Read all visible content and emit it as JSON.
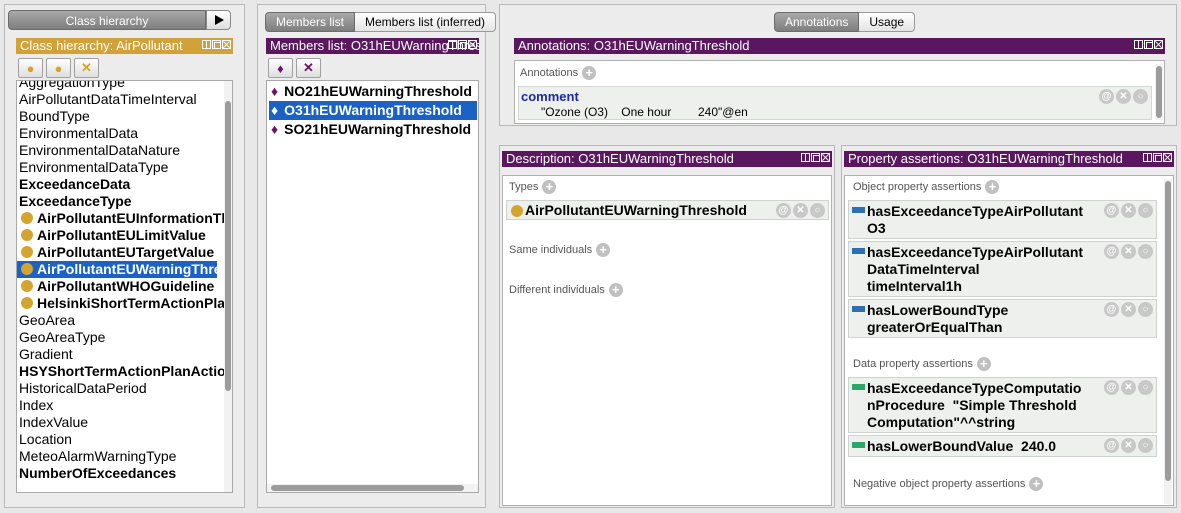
{
  "left": {
    "tab_label": "Class hierarchy",
    "play_icon": "play-triangle-icon",
    "title": "Class hierarchy: AirPollutant",
    "toolbar": [
      "add-subclass-icon",
      "add-sibling-icon",
      "delete-class-icon"
    ],
    "items": [
      {
        "label": "AggregationType",
        "bold": false,
        "dot": false,
        "sel": false
      },
      {
        "label": "AirPollutantDataTimeInterval",
        "bold": false,
        "dot": false,
        "sel": false
      },
      {
        "label": "BoundType",
        "bold": false,
        "dot": false,
        "sel": false
      },
      {
        "label": "EnvironmentalData",
        "bold": false,
        "dot": false,
        "sel": false
      },
      {
        "label": "EnvironmentalDataNature",
        "bold": false,
        "dot": false,
        "sel": false
      },
      {
        "label": "EnvironmentalDataType",
        "bold": false,
        "dot": false,
        "sel": false
      },
      {
        "label": "ExceedanceData",
        "bold": true,
        "dot": false,
        "sel": false
      },
      {
        "label": "ExceedanceType",
        "bold": true,
        "dot": false,
        "sel": false
      },
      {
        "label": "AirPollutantEUInformationThreshold",
        "bold": true,
        "dot": true,
        "sel": false
      },
      {
        "label": "AirPollutantEULimitValue",
        "bold": true,
        "dot": true,
        "sel": false
      },
      {
        "label": "AirPollutantEUTargetValue",
        "bold": true,
        "dot": true,
        "sel": false
      },
      {
        "label": "AirPollutantEUWarningThreshold",
        "bold": true,
        "dot": true,
        "sel": true
      },
      {
        "label": "AirPollutantWHOGuideline",
        "bold": true,
        "dot": true,
        "sel": false
      },
      {
        "label": "HelsinkiShortTermActionPlan",
        "bold": true,
        "dot": true,
        "sel": false
      },
      {
        "label": "GeoArea",
        "bold": false,
        "dot": false,
        "sel": false
      },
      {
        "label": "GeoAreaType",
        "bold": false,
        "dot": false,
        "sel": false
      },
      {
        "label": "Gradient",
        "bold": false,
        "dot": false,
        "sel": false
      },
      {
        "label": "HSYShortTermActionPlanAction",
        "bold": true,
        "dot": false,
        "sel": false
      },
      {
        "label": "HistoricalDataPeriod",
        "bold": false,
        "dot": false,
        "sel": false
      },
      {
        "label": "Index",
        "bold": false,
        "dot": false,
        "sel": false
      },
      {
        "label": "IndexValue",
        "bold": false,
        "dot": false,
        "sel": false
      },
      {
        "label": "Location",
        "bold": false,
        "dot": false,
        "sel": false
      },
      {
        "label": "MeteoAlarmWarningType",
        "bold": false,
        "dot": false,
        "sel": false
      },
      {
        "label": "NumberOfExceedances",
        "bold": true,
        "dot": false,
        "sel": false
      }
    ],
    "scroll_fraction": 0.55
  },
  "members": {
    "tabs": [
      "Members list",
      "Members list (inferred)"
    ],
    "title": "Members list: O31hEUWarningThreshold",
    "toolbar": [
      "add-individual-icon",
      "delete-individual-icon"
    ],
    "items": [
      {
        "label": "NO21hEUWarningThreshold",
        "sel": false
      },
      {
        "label": "O31hEUWarningThreshold",
        "sel": true
      },
      {
        "label": "SO21hEUWarningThreshold",
        "sel": false
      }
    ]
  },
  "annotations": {
    "tabs": [
      "Annotations",
      "Usage"
    ],
    "title": "Annotations: O31hEUWarningThreshold",
    "section_label": "Annotations",
    "prop": "comment",
    "value": "\"Ozone (O3)    One hour        240\"@en"
  },
  "description": {
    "title": "Description: O31hEUWarningThreshold",
    "types_label": "Types",
    "type_value": "AirPollutantEUWarningThreshold",
    "same_label": "Same individuals",
    "different_label": "Different individuals"
  },
  "assertions": {
    "title": "Property assertions: O31hEUWarningThreshold",
    "object_label": "Object property assertions",
    "object_items": [
      {
        "lines": [
          "hasExceedanceTypeAirPollutant",
          "O3"
        ]
      },
      {
        "lines": [
          "hasExceedanceTypeAirPollutant",
          "DataTimeInterval",
          "timeInterval1h"
        ]
      },
      {
        "lines": [
          "hasLowerBoundType",
          "greaterOrEqualThan"
        ]
      }
    ],
    "data_label": "Data property assertions",
    "data_items": [
      {
        "lines": [
          "hasExceedanceTypeComputatio",
          "nProcedure  \"Simple Threshold",
          "Computation\"^^string"
        ]
      },
      {
        "lines": [
          "hasLowerBoundValue  240.0"
        ]
      }
    ],
    "negative_label": "Negative object property assertions",
    "colors": {
      "object": "#2e6fb0",
      "data": "#2aa86a"
    }
  }
}
